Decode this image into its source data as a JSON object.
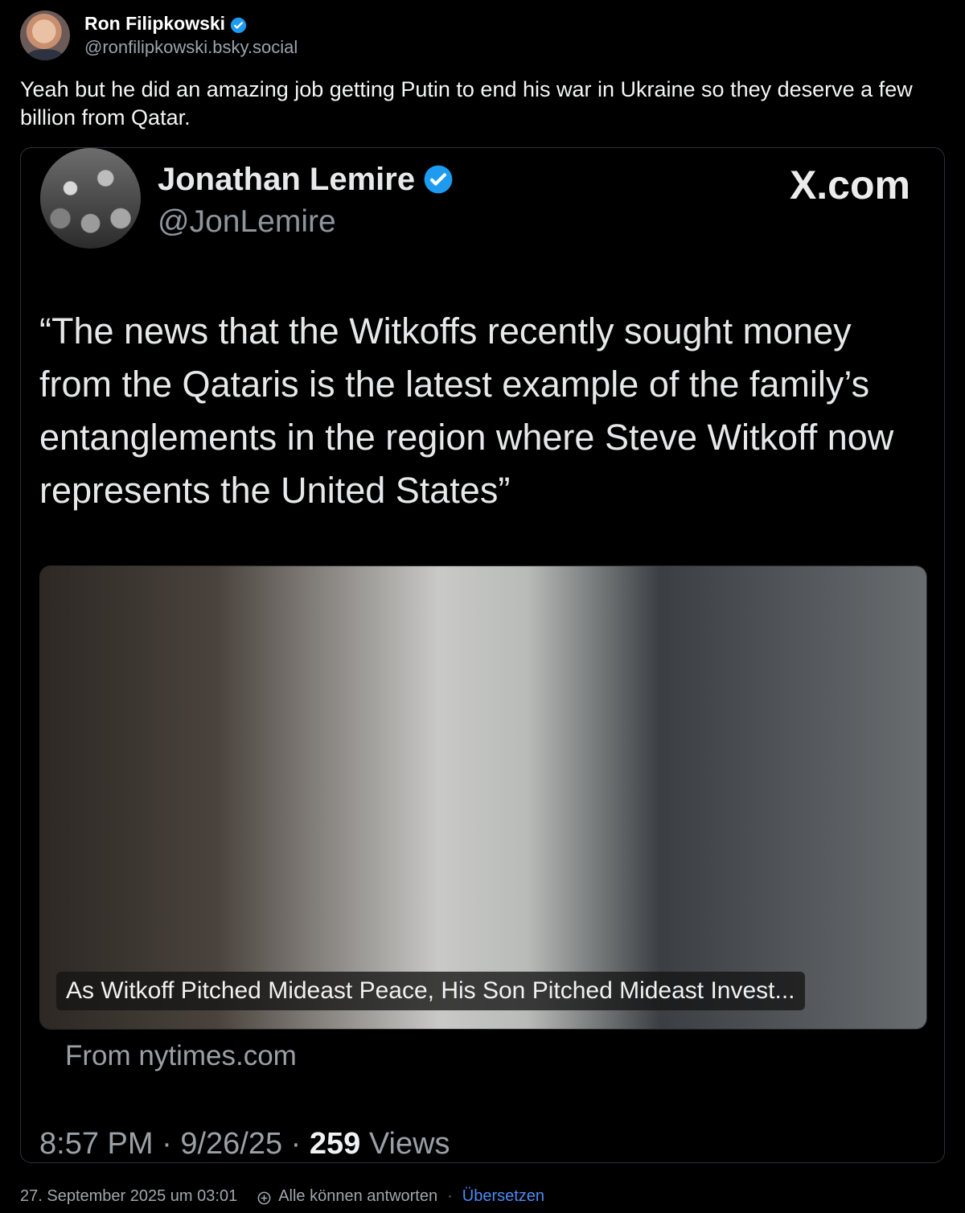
{
  "post": {
    "author": {
      "name": "Ron Filipkowski",
      "handle": "@ronfilipkowski.bsky.social"
    },
    "text": "Yeah but he did an amazing job getting Putin to end his war in Ukraine so they deserve a few billion from Qatar.",
    "footer": {
      "timestamp": "27. September 2025 um 03:01",
      "reply_permission": "Alle können antworten",
      "separator": "·",
      "translate_label": "Übersetzen"
    }
  },
  "quoted_tweet": {
    "author_name": "Jonathan Lemire",
    "author_handle": "@JonLemire",
    "logo_text": "X.com",
    "quote": "“The news that the Witkoffs recently sought money from the Qataris is the latest example of the family’s entanglements in the region where Steve Witkoff now represents the United States”",
    "article": {
      "headline": "As Witkoff Pitched Mideast Peace, His Son Pitched Mideast Invest...",
      "source": "From nytimes.com"
    },
    "meta": {
      "time": "8:57 PM",
      "date": "9/26/25",
      "views_count": "259",
      "views_label": "Views",
      "separator": "·"
    }
  },
  "icons": {
    "verified": "verified-badge-icon",
    "reply": "reply-settings-icon"
  },
  "colors": {
    "verified_blue": "#1d9bf0",
    "link_blue": "#4b8bf5",
    "muted_text": "#9aa3ad"
  }
}
